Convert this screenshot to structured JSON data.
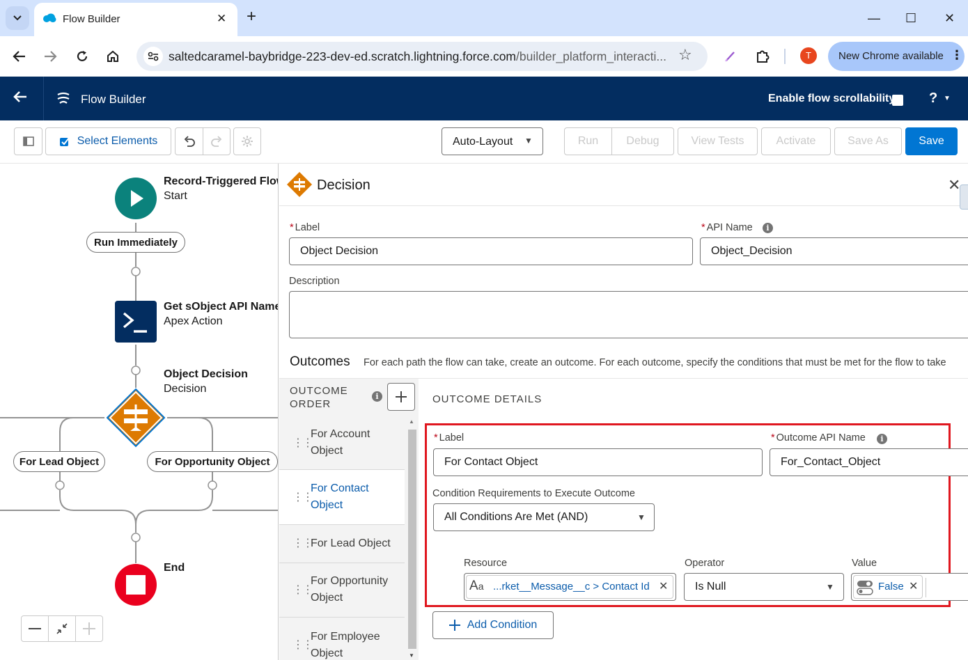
{
  "browser": {
    "tab_title": "Flow Builder",
    "url_host": "saltedcaramel-baybridge-223-dev-ed.scratch.lightning.force.com",
    "url_path": "/builder_platform_interacti...",
    "avatar_initial": "T",
    "update_label": "New Chrome available"
  },
  "header": {
    "app_title": "Flow Builder",
    "scrollability_label": "Enable flow scrollability",
    "help_label": "?"
  },
  "toolbar": {
    "select_elements": "Select Elements",
    "layout_mode": "Auto-Layout",
    "run": "Run",
    "debug": "Debug",
    "view_tests": "View Tests",
    "activate": "Activate",
    "save_as": "Save As",
    "save": "Save"
  },
  "canvas": {
    "start_title": "Record-Triggered Flow",
    "start_sub": "Start",
    "run_immediately": "Run Immediately",
    "action_title": "Get sObject API Name",
    "action_sub": "Apex Action",
    "decision_title": "Object Decision",
    "decision_sub": "Decision",
    "branch_left": "For Lead Object",
    "branch_right": "For Opportunity Object",
    "end_title": "End"
  },
  "panel": {
    "title": "Decision",
    "label_field": "Label",
    "label_value": "Object Decision",
    "api_name_field": "API Name",
    "api_name_value": "Object_Decision",
    "description_field": "Description",
    "outcomes_title": "Outcomes",
    "outcomes_desc": "For each path the flow can take, create an outcome. For each outcome, specify the conditions that must be met for the flow to take",
    "outcome_order_label": "OUTCOME ORDER",
    "outcomes": [
      {
        "label": "For Account Object",
        "active": false
      },
      {
        "label": "For Contact Object",
        "active": true
      },
      {
        "label": "For Lead Object",
        "active": false
      },
      {
        "label": "For Opportunity Object",
        "active": false
      },
      {
        "label": "For Employee Object",
        "active": false
      }
    ],
    "details": {
      "heading": "OUTCOME DETAILS",
      "label_field": "Label",
      "label_value": "For Contact Object",
      "api_name_field": "Outcome API Name",
      "api_name_value": "For_Contact_Object",
      "condition_req_field": "Condition Requirements to Execute Outcome",
      "condition_req_value": "All Conditions Are Met (AND)",
      "resource_field": "Resource",
      "resource_value": "...rket__Message__c > Contact Id",
      "operator_field": "Operator",
      "operator_value": "Is Null",
      "value_field": "Value",
      "value_value": "False",
      "add_condition": "Add Condition"
    }
  },
  "colors": {
    "header_bg": "#032d60",
    "brand_blue": "#0176d3",
    "start_node": "#0b827c",
    "action_node": "#032d60",
    "decision_node": "#dd7a01",
    "end_node": "#ea001e",
    "highlight": "#e0171f"
  }
}
